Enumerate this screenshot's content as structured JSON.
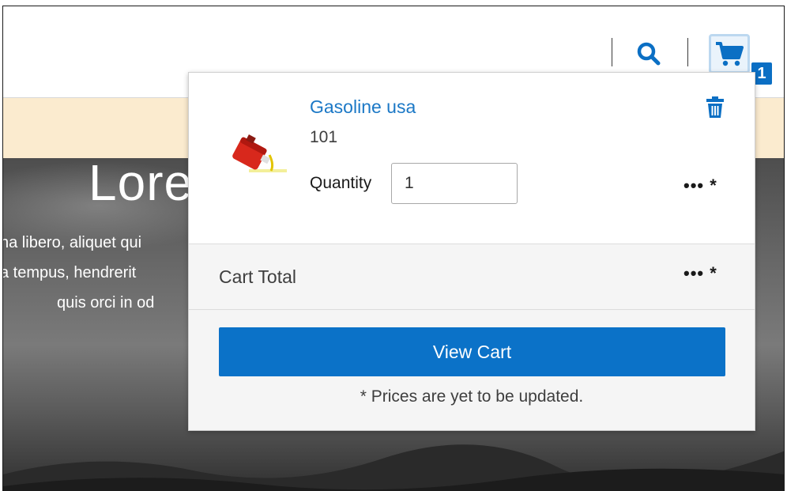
{
  "header": {
    "search_icon": "search-icon",
    "cart_icon": "cart-icon",
    "cart_count": "1"
  },
  "hero": {
    "title": "Lore",
    "lines": [
      "na libero, aliquet qui",
      "a tempus, hendrerit",
      "quis orci in od"
    ]
  },
  "cart_popup": {
    "item": {
      "name": "Gasoline usa",
      "sku": "101",
      "quantity_label": "Quantity",
      "quantity_value": "1",
      "price": "••• *"
    },
    "total_label": "Cart Total",
    "total_value": "••• *",
    "view_cart_label": "View Cart",
    "note": "* Prices are yet to be updated."
  },
  "colors": {
    "brand_blue": "#0b72c8",
    "link_blue": "#1b78c6",
    "banner": "#fbebcf"
  }
}
